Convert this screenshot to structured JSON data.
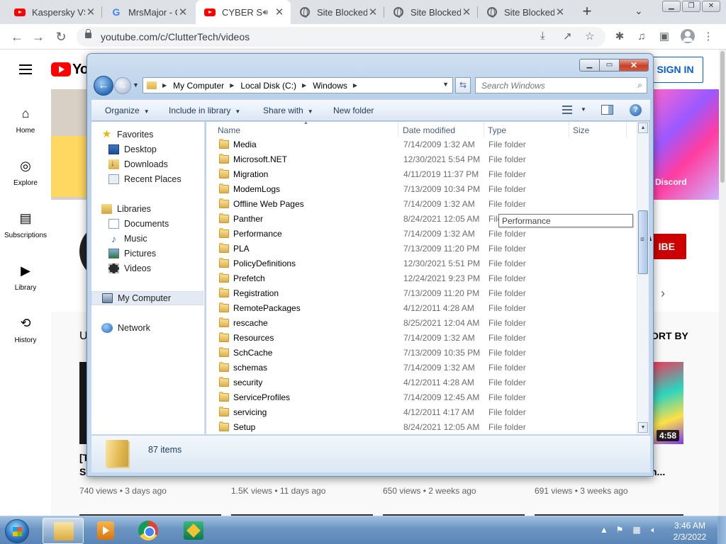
{
  "browser": {
    "tabs": [
      {
        "title": "Kaspersky VS",
        "favicon": "youtube-icon"
      },
      {
        "title": "MrsMajor - G",
        "favicon": "google-icon"
      },
      {
        "title": "CYBER S",
        "favicon": "youtube-icon",
        "active": true,
        "audio": true
      },
      {
        "title": "Site Blocked",
        "favicon": "globe-icon"
      },
      {
        "title": "Site Blocked",
        "favicon": "globe-icon"
      },
      {
        "title": "Site Blocked",
        "favicon": "globe-icon"
      }
    ],
    "url": "youtube.com/c/ClutterTech/videos"
  },
  "youtube": {
    "logo_text": "Yo",
    "signin_label": "SIGN IN",
    "nav": [
      {
        "label": "Home",
        "icon": "home-icon"
      },
      {
        "label": "Explore",
        "icon": "compass-icon"
      },
      {
        "label": "Subscriptions",
        "icon": "subscriptions-icon"
      },
      {
        "label": "Library",
        "icon": "library-icon"
      },
      {
        "label": "History",
        "icon": "history-icon"
      }
    ],
    "banner_link": "Discord",
    "subscribe_label": "IBE",
    "sort_by": "ORT BY",
    "uploads_initial": "U",
    "video_fragments": {
      "first": "[T",
      "first_line2": "S",
      "last": "n..."
    },
    "duration": "4:58",
    "videos": [
      {
        "views": "740 views • 3 days ago"
      },
      {
        "views": "1.5K views • 11 days ago"
      },
      {
        "views": "650 views • 2 weeks ago"
      },
      {
        "views": "691 views • 3 weeks ago"
      }
    ]
  },
  "explorer": {
    "breadcrumb": [
      "My Computer",
      "Local Disk (C:)",
      "Windows"
    ],
    "search_placeholder": "Search Windows",
    "commands": {
      "organize": "Organize",
      "include": "Include in library",
      "share": "Share with",
      "new_folder": "New folder"
    },
    "nav": {
      "favorites": "Favorites",
      "favorites_items": [
        "Desktop",
        "Downloads",
        "Recent Places"
      ],
      "libraries": "Libraries",
      "libraries_items": [
        "Documents",
        "Music",
        "Pictures",
        "Videos"
      ],
      "computer": "My Computer",
      "network": "Network"
    },
    "columns": {
      "name": "Name",
      "date": "Date modified",
      "type": "Type",
      "size": "Size"
    },
    "files": [
      {
        "name": "Media",
        "date": "7/14/2009 1:32 AM",
        "type": "File folder"
      },
      {
        "name": "Microsoft.NET",
        "date": "12/30/2021 5:54 PM",
        "type": "File folder"
      },
      {
        "name": "Migration",
        "date": "4/11/2019 11:37 PM",
        "type": "File folder"
      },
      {
        "name": "ModemLogs",
        "date": "7/13/2009 10:34 PM",
        "type": "File folder"
      },
      {
        "name": "Offline Web Pages",
        "date": "7/14/2009 1:32 AM",
        "type": "File folder"
      },
      {
        "name": "Panther",
        "date": "8/24/2021 12:05 AM",
        "type": "File folder"
      },
      {
        "name": "Performance",
        "date": "7/14/2009 1:32 AM",
        "type": "File folder"
      },
      {
        "name": "PLA",
        "date": "7/13/2009 11:20 PM",
        "type": "File folder"
      },
      {
        "name": "PolicyDefinitions",
        "date": "12/30/2021 5:51 PM",
        "type": "File folder"
      },
      {
        "name": "Prefetch",
        "date": "12/24/2021 9:23 PM",
        "type": "File folder"
      },
      {
        "name": "Registration",
        "date": "7/13/2009 11:20 PM",
        "type": "File folder"
      },
      {
        "name": "RemotePackages",
        "date": "4/12/2011 4:28 AM",
        "type": "File folder"
      },
      {
        "name": "rescache",
        "date": "8/25/2021 12:04 AM",
        "type": "File folder"
      },
      {
        "name": "Resources",
        "date": "7/14/2009 1:32 AM",
        "type": "File folder"
      },
      {
        "name": "SchCache",
        "date": "7/13/2009 10:35 PM",
        "type": "File folder"
      },
      {
        "name": "schemas",
        "date": "7/14/2009 1:32 AM",
        "type": "File folder"
      },
      {
        "name": "security",
        "date": "4/12/2011 4:28 AM",
        "type": "File folder"
      },
      {
        "name": "ServiceProfiles",
        "date": "7/14/2009 12:45 AM",
        "type": "File folder"
      },
      {
        "name": "servicing",
        "date": "4/12/2011 4:17 AM",
        "type": "File folder"
      },
      {
        "name": "Setup",
        "date": "8/24/2021 12:05 AM",
        "type": "File folder"
      }
    ],
    "tooltip": "Performance",
    "item_count": "87 items"
  },
  "taskbar": {
    "apps": [
      "windows-explorer-icon",
      "media-player-icon",
      "chrome-icon",
      "kaspersky-icon"
    ],
    "time": "3:46 AM",
    "date": "2/3/2022"
  },
  "colors": {
    "youtube_red": "#ff0000",
    "signin_blue": "#065fd4",
    "explorer_chrome": "#c5d9ee",
    "taskbar": "#6b95c2"
  }
}
